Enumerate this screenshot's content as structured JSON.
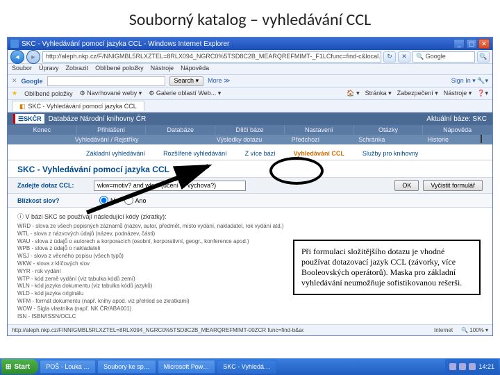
{
  "slide": {
    "title": "Souborný katalog – vyhledávání CCL"
  },
  "window": {
    "title": "SKC - Vyhledávání pomocí jazyka CCL - Windows Internet Explorer",
    "url": "http://aleph.nkp.cz/F/NNIGMBL5RLXZTEL=8RLX094_NGRC0%5TSD8C2B_MEARQREFMIMT-_F1LCfunc=find-c&local..."
  },
  "ie_menu": [
    "Soubor",
    "Úpravy",
    "Zobrazit",
    "Oblíbené položky",
    "Nástroje",
    "Nápověda"
  ],
  "google_bar": {
    "label": "Google",
    "search_btn": "Search ▾",
    "more": "More ≫",
    "signin": "Sign In ▾ 🔧▾"
  },
  "fav_bar": {
    "fav": "Oblíbené položky",
    "items": [
      "⚙ Navrhované weby ▾",
      "⚙ Galerie oblastí Web... ▾"
    ],
    "right": [
      "🏠 ▾",
      "Stránka ▾",
      "Zabezpečení ▾",
      "Nástroje ▾",
      "❓▾"
    ]
  },
  "tab": {
    "label": "SKC - Vyhledávání pomocí jazyka CCL"
  },
  "skc": {
    "header": "Databáze Národní knihovny ČR",
    "base": "Aktuální báze: SKC",
    "row1": [
      "Konec",
      "Přihlášení",
      "Databáze",
      "Dílčí báze",
      "Nastavení",
      "Otázky",
      "Nápověda"
    ],
    "row2": [
      "",
      "Vyhledávání / Rejstříky",
      "",
      "Výsledky dotazu",
      "Předchozí",
      "Schránka",
      "Historie",
      ""
    ],
    "subtabs": [
      "Základní vyhledávání",
      "Rozšířené vyhledávání",
      "Z více bází",
      "Vyhledávání CCL",
      "Služby pro knihovny"
    ],
    "page_heading": "SKC - Vyhledávání pomocí jazyka CCL",
    "ccl_label": "Zadejte dotaz CCL:",
    "ccl_value": "wkw=motiv? and wkw=(učení or výchova?)",
    "ok": "OK",
    "clear": "Vyčistit formulář",
    "prox_label": "Blízkost slov?",
    "prox_no": "Ne",
    "prox_yes": "Ano",
    "codes_intro": "ⓘ V bázi SKC se používají následující kódy (zkratky):",
    "codes": [
      "WRD - slova ze všech popisných záznamů (název, autor, předmět, místo vydání, nakladatel, rok vydání atd.)",
      "WTL - slova z názvových údajů (název, podnázev, části)",
      "WAU - slova z údajů o autorech a korporacích (osobní, korporativní, geogr., konference apod.)",
      "WPB - slova z údajů o nakladateli",
      "WSJ - slova z věcného popisu (všech typů)",
      "WKW - slova z klíčových slov",
      "WYR - rok vydání",
      "WTP - kód země vydání (viz tabulka kódů zemí)",
      "WLN - kód jazyka dokumentu (viz tabulka kódů jazyků)",
      "WLD - kód jazyka originálu",
      "WFM - formát dokumentu (např. knihy apod. viz přehled se zkratkami)",
      "WOW - Sigla vlastníka (např. NK ČR/ABA001)",
      "ISN - ISBN/ISSN/OCLC"
    ]
  },
  "callout": "Při formulaci složitějšího dotazu je vhodné používat dotazovací jazyk CCL (závorky, více Booleovských operátorů). Maska pro základní vyhledávání neumožňuje sofistikovanou rešerši.",
  "status": {
    "left": "http://aleph.nkp.cz/F/NNIGMBL5RLXZTEL=8RLX094_NGRC0%5TSD8C2B_MEARQREFMIMT-00ZCR func=find-b&adjacent=N&file_name=fin...",
    "zone": "Internet",
    "zoom": "🔍 100% ▾"
  },
  "taskbar": {
    "start": "Start",
    "tasks": [
      "POŠ - Louka …",
      "Soubory ke sp…",
      "Microsoft Pow…",
      "SKC - Vyhledá…"
    ],
    "time": "14:21"
  }
}
